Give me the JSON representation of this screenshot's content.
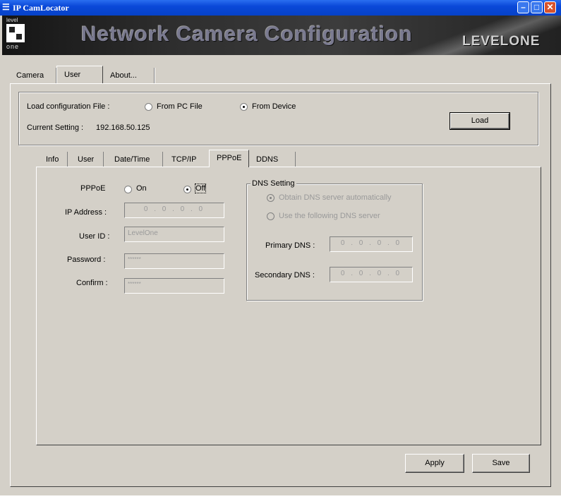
{
  "window": {
    "title": "IP CamLocator",
    "icon": "app-icon",
    "controls": [
      "minimize",
      "maximize",
      "close"
    ]
  },
  "banner": {
    "logo_top": "level",
    "logo_bottom": "one",
    "title": "Network Camera Configuration",
    "brand": "LEVELONE"
  },
  "main_tabs": [
    {
      "label": "Camera",
      "active": false
    },
    {
      "label": "User",
      "active": true
    },
    {
      "label": "About...",
      "active": false
    }
  ],
  "load": {
    "label": "Load configuration File :",
    "options": [
      {
        "label": "From PC File",
        "selected": false
      },
      {
        "label": "From Device",
        "selected": true
      }
    ],
    "current_label": "Current Setting :",
    "current_value": "192.168.50.125",
    "button": "Load"
  },
  "sub_tabs": [
    {
      "label": "Info",
      "active": false
    },
    {
      "label": "User",
      "active": false
    },
    {
      "label": "Date/Time",
      "active": false
    },
    {
      "label": "TCP/IP",
      "active": false
    },
    {
      "label": "PPPoE",
      "active": true
    },
    {
      "label": "DDNS",
      "active": false
    }
  ],
  "pppoe": {
    "label": "PPPoE",
    "on_label": "On",
    "off_label": "Off",
    "selected": "Off",
    "ip_label": "IP Address :",
    "ip_value": "0 . 0 . 0 . 0",
    "user_label": "User ID :",
    "user_value": "LevelOne",
    "password_label": "Password :",
    "password_value": "******",
    "confirm_label": "Confirm :",
    "confirm_value": "******"
  },
  "dns": {
    "legend": "DNS Setting",
    "auto_label": "Obtain DNS server automatically",
    "manual_label": "Use the following DNS server",
    "selected": "auto",
    "primary_label": "Primary DNS :",
    "primary_value": "0 . 0 . 0 . 0",
    "secondary_label": "Secondary DNS :",
    "secondary_value": "0 . 0 . 0 . 0"
  },
  "actions": {
    "apply": "Apply",
    "save": "Save"
  }
}
